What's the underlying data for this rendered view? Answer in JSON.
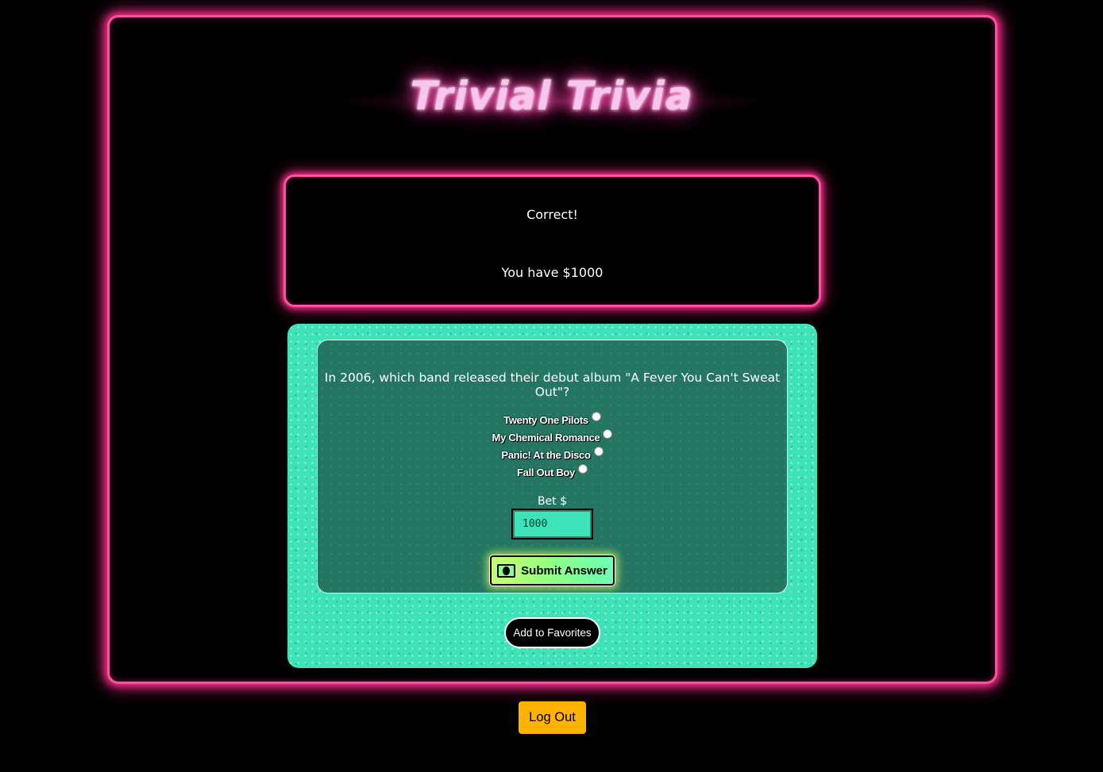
{
  "header": {
    "title": "Trivial Trivia"
  },
  "status": {
    "result": "Correct!",
    "money": "You have $1000"
  },
  "question": {
    "text": "In 2006, which band released their debut album \"A Fever You Can't Sweat Out\"?",
    "options": [
      {
        "label": "Twenty One Pilots"
      },
      {
        "label": "My Chemical Romance"
      },
      {
        "label": "Panic! At the Disco"
      },
      {
        "label": "Fall Out Boy"
      }
    ]
  },
  "bet": {
    "label": "Bet $",
    "value": "1000"
  },
  "buttons": {
    "submit_label": "Submit Answer",
    "submit_icon": "money-bill-icon",
    "favorites_label": "Add to Favorites",
    "logout_label": "Log Out"
  },
  "colors": {
    "neon_pink": "#ff4fa3",
    "panel_teal": "#3fe3b9",
    "card_green": "#247562",
    "logout_amber": "#ffb300"
  }
}
